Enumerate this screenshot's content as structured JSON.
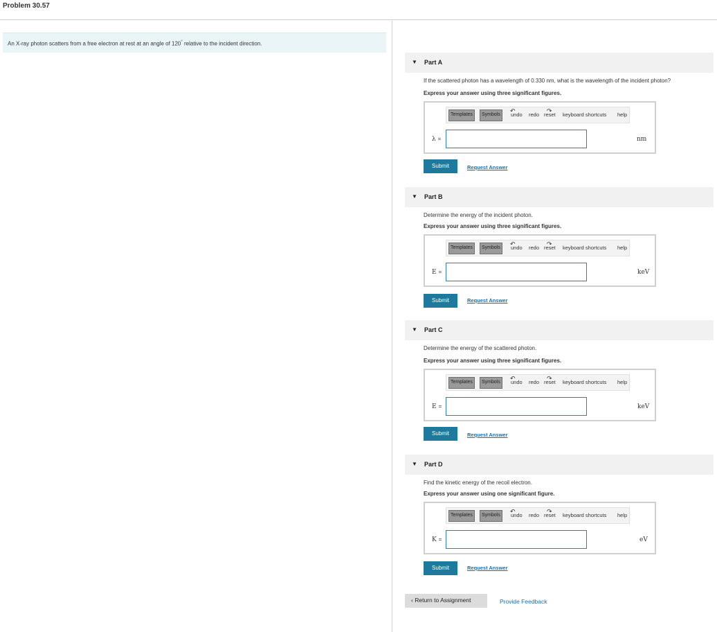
{
  "header": {
    "title": "Problem 30.57"
  },
  "stem": {
    "text_before": "An X-ray photon scatters from a free electron at rest at an angle of 120",
    "degree": "°",
    "text_after": " relative to the incident direction."
  },
  "toolbar": {
    "templates_label": "Templates",
    "symbols_label": "Symbols",
    "undo_label": "undo",
    "redo_label": "redo",
    "reset_label": "reset",
    "shortcuts_label": "keyboard shortcuts",
    "help_label": "help"
  },
  "parts": [
    {
      "label": "Part A",
      "question": "If the scattered photon has a wavelength of 0.330 nm, what is the wavelength of the incident photon?",
      "instruction": "Express your answer using three significant figures.",
      "variable": "λ",
      "equals": "=",
      "unit": "nm",
      "input_value": ""
    },
    {
      "label": "Part B",
      "question": "Determine the energy of the incident photon.",
      "instruction": "Express your answer using three significant figures.",
      "variable": "E",
      "equals": "=",
      "unit": "keV",
      "input_value": ""
    },
    {
      "label": "Part C",
      "question": "Determine the energy of the scattered photon.",
      "instruction": "Express your answer using three significant figures.",
      "variable": "E",
      "equals": "=",
      "unit": "keV",
      "input_value": ""
    },
    {
      "label": "Part D",
      "question": "Find the kinetic energy of the recoil electron.",
      "instruction": "Express your answer using one significant figure.",
      "variable": "K",
      "equals": "=",
      "unit": "eV",
      "input_value": ""
    }
  ],
  "actions": {
    "submit_label": "Submit",
    "request_label": "Request Answer",
    "return_label": "Return to Assignment",
    "return_icon": "‹",
    "feedback_label": "Provide Feedback"
  },
  "icons": {
    "collapse": "▼",
    "undo": "↶",
    "redo": "↷",
    "reset": "↻"
  },
  "colors": {
    "submit_bg": "#1e7a9c",
    "link": "#1a6fae",
    "input_border": "#2d7fb0",
    "stem_bg": "#e9f5f7"
  }
}
